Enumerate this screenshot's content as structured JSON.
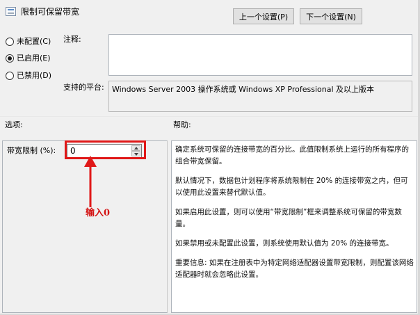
{
  "window": {
    "title": "限制可保留带宽"
  },
  "nav": {
    "prev_label": "上一个设置(P)",
    "next_label": "下一个设置(N)"
  },
  "state_options": [
    {
      "label": "未配置(C)",
      "checked": false
    },
    {
      "label": "已启用(E)",
      "checked": true
    },
    {
      "label": "已禁用(D)",
      "checked": false
    }
  ],
  "comment": {
    "label": "注释:",
    "value": ""
  },
  "platform": {
    "label": "支持的平台:",
    "value": "Windows Server 2003 操作系统或 Windows XP Professional 及以上版本"
  },
  "options": {
    "header": "选项:",
    "bandwidth_label": "带宽限制 (%):",
    "bandwidth_value": "0"
  },
  "help": {
    "header": "帮助:",
    "paragraphs": [
      "确定系统可保留的连接带宽的百分比。此值限制系统上运行的所有程序的组合带宽保留。",
      "默认情况下，数据包计划程序将系统限制在 20% 的连接带宽之内，但可以使用此设置来替代默认值。",
      "如果启用此设置，则可以使用“带宽限制”框来调整系统可保留的带宽数量。",
      "如果禁用或未配置此设置，则系统使用默认值为 20% 的连接带宽。",
      "重要信息: 如果在注册表中为特定网络适配器设置带宽限制，则配置该网络适配器时就会忽略此设置。"
    ]
  },
  "annotation": {
    "text": "输入0",
    "color": "#d41414"
  }
}
